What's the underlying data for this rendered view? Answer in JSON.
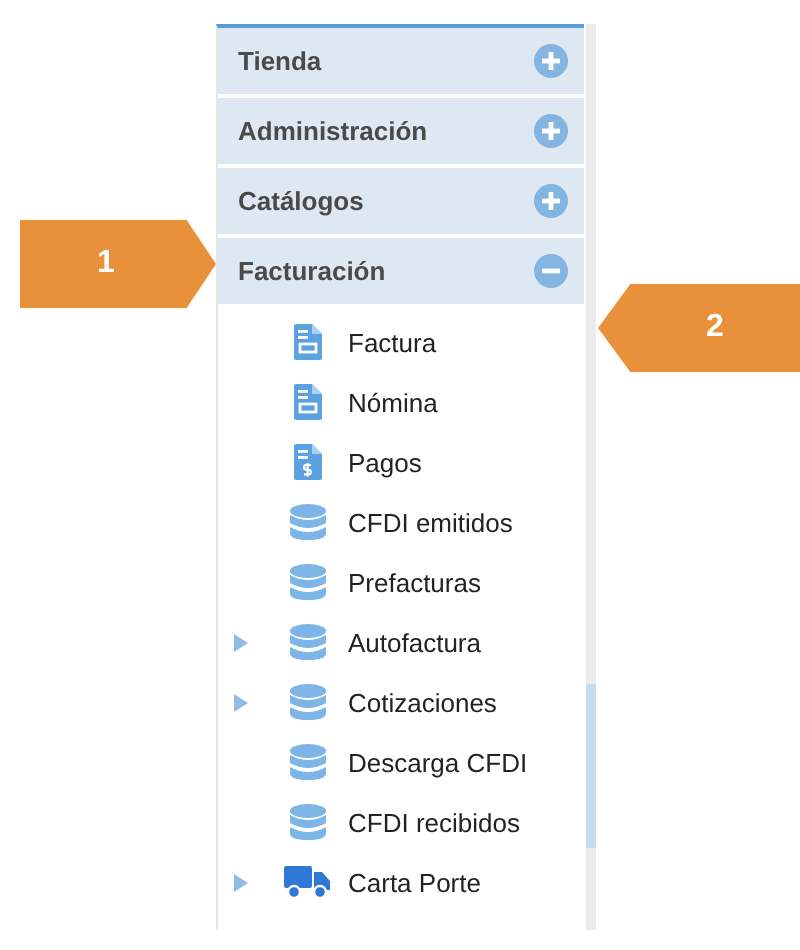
{
  "sections": [
    {
      "label": "Tienda",
      "expanded": false
    },
    {
      "label": "Administración",
      "expanded": false
    },
    {
      "label": "Catálogos",
      "expanded": false
    },
    {
      "label": "Facturación",
      "expanded": true,
      "items": [
        {
          "label": "Factura",
          "kind": "document",
          "expandable": false
        },
        {
          "label": "Nómina",
          "kind": "document",
          "expandable": false
        },
        {
          "label": "Pagos",
          "kind": "payment",
          "expandable": false
        },
        {
          "label": "CFDI emitidos",
          "kind": "database",
          "expandable": false
        },
        {
          "label": "Prefacturas",
          "kind": "database",
          "expandable": false
        },
        {
          "label": "Autofactura",
          "kind": "database",
          "expandable": true
        },
        {
          "label": "Cotizaciones",
          "kind": "database",
          "expandable": true
        },
        {
          "label": "Descarga CFDI",
          "kind": "database",
          "expandable": false
        },
        {
          "label": "CFDI recibidos",
          "kind": "database",
          "expandable": false
        },
        {
          "label": "Carta Porte",
          "kind": "truck",
          "expandable": true
        }
      ]
    }
  ],
  "callouts": [
    {
      "label": "1",
      "kind": "rightward"
    },
    {
      "label": "2",
      "kind": "leftward"
    }
  ]
}
